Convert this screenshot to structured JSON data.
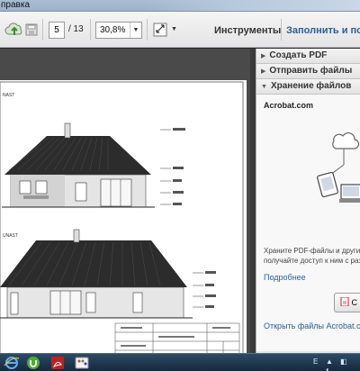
{
  "menubar": {
    "items": [
      "правка"
    ]
  },
  "toolbar": {
    "page_current": "5",
    "page_total": "/ 13",
    "zoom": "30,8%",
    "tools_label": "Инструменты",
    "fill_label": "Заполнить и под"
  },
  "pane": {
    "sections": [
      {
        "label": "Создать PDF",
        "expanded": false
      },
      {
        "label": "Отправить файлы",
        "expanded": false
      },
      {
        "label": "Хранение файлов",
        "expanded": true
      }
    ],
    "subtitle": "Acrobat.com",
    "desc_line1": "Храните PDF-файлы и други",
    "desc_line2": "получайте доступ к ним с раз",
    "more_link": "Подробнее",
    "button_label": "С",
    "open_link": "Открыть файлы Acrobat.com"
  },
  "drawing": {
    "label_top": "NAST",
    "label_bottom": "UNAST"
  },
  "taskbar": {
    "apps": [
      "ie-icon",
      "utorrent-icon",
      "acrobat-icon",
      "paint-icon"
    ],
    "tray_lang": "E"
  },
  "colors": {
    "link": "#2a5f96",
    "roof": "#2d2d2d",
    "taskbar": "#1d3550"
  }
}
